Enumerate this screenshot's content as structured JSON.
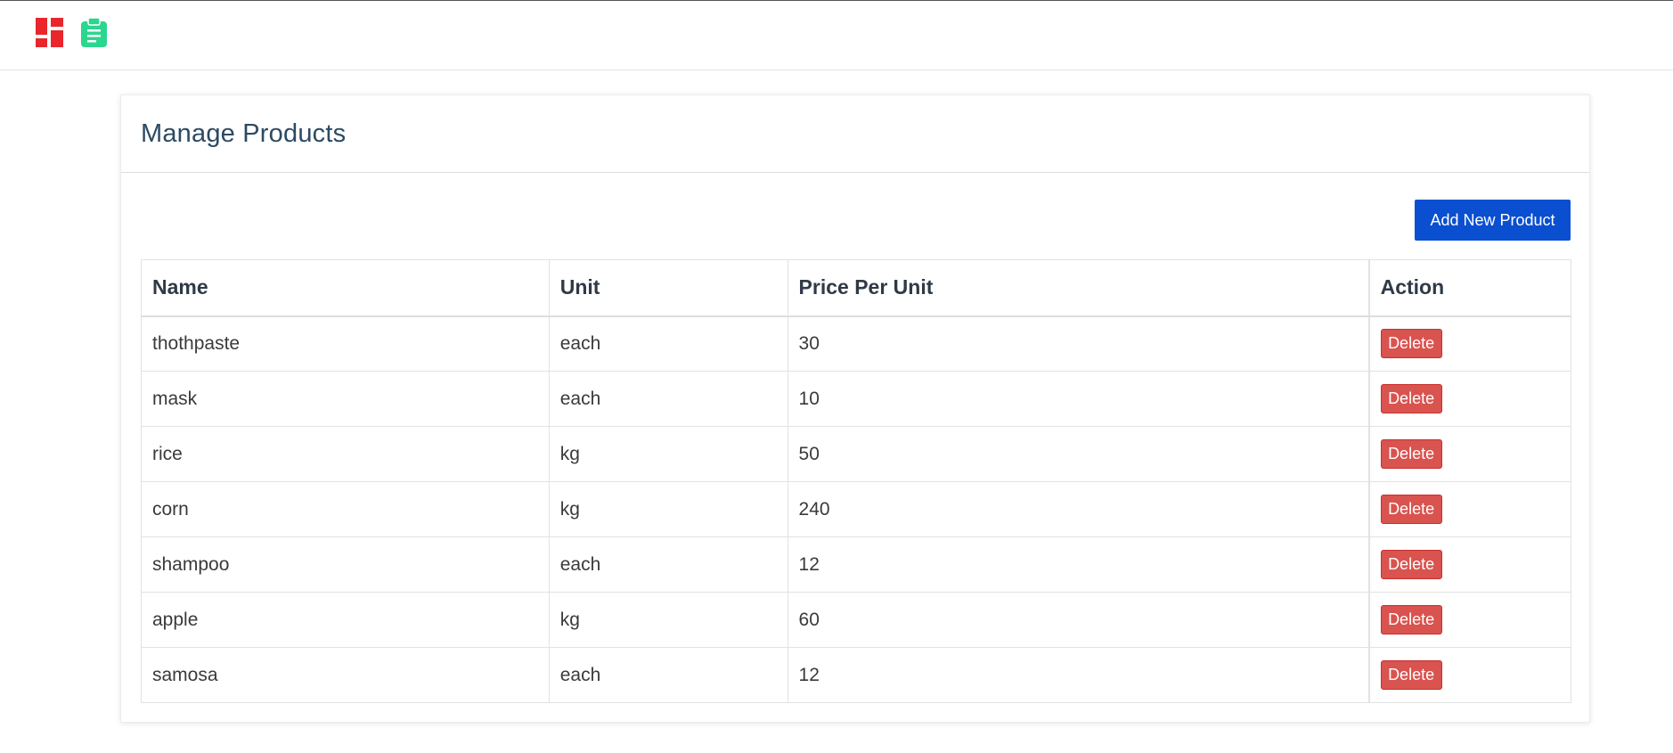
{
  "nav": {
    "icons": [
      "dashboard-icon",
      "clipboard-icon"
    ],
    "colors": {
      "dashboard": "#e8262b",
      "orders": "#2bd68f"
    }
  },
  "card": {
    "title": "Manage Products",
    "add_button_label": "Add New Product"
  },
  "table": {
    "headers": [
      "Name",
      "Unit",
      "Price Per Unit",
      "Action"
    ],
    "rows": [
      {
        "name": "thothpaste",
        "unit": "each",
        "price": "30",
        "action": "Delete"
      },
      {
        "name": "mask",
        "unit": "each",
        "price": "10",
        "action": "Delete"
      },
      {
        "name": "rice",
        "unit": "kg",
        "price": "50",
        "action": "Delete"
      },
      {
        "name": "corn",
        "unit": "kg",
        "price": "240",
        "action": "Delete"
      },
      {
        "name": "shampoo",
        "unit": "each",
        "price": "12",
        "action": "Delete"
      },
      {
        "name": "apple",
        "unit": "kg",
        "price": "60",
        "action": "Delete"
      },
      {
        "name": "samosa",
        "unit": "each",
        "price": "12",
        "action": "Delete"
      }
    ]
  },
  "colors": {
    "primary_button": "#0a4fd0",
    "danger_button": "#d9534f",
    "title_text": "#2c4a63"
  }
}
